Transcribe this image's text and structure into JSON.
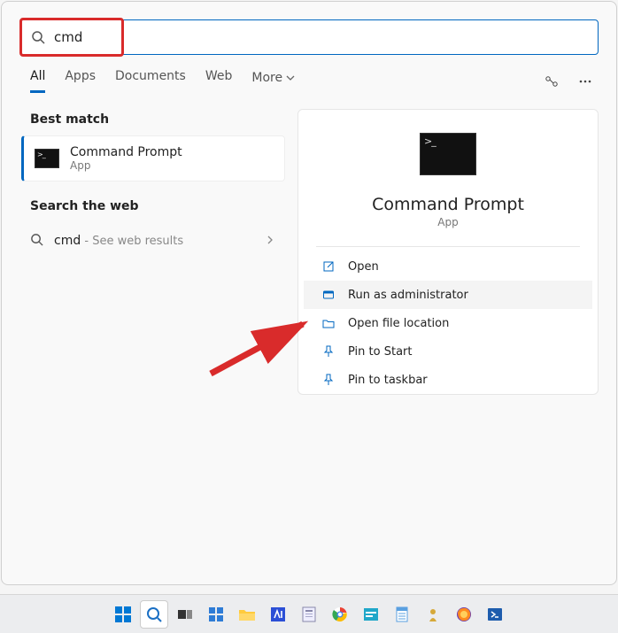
{
  "search": {
    "value": "cmd"
  },
  "tabs": {
    "all": "All",
    "apps": "Apps",
    "documents": "Documents",
    "web": "Web",
    "more": "More"
  },
  "left": {
    "best_match_label": "Best match",
    "match": {
      "title": "Command Prompt",
      "sub": "App"
    },
    "search_web_label": "Search the web",
    "web_item": {
      "term": "cmd",
      "suffix": " - See web results"
    }
  },
  "right": {
    "title": "Command Prompt",
    "sub": "App",
    "actions": {
      "open": "Open",
      "run_admin": "Run as administrator",
      "open_loc": "Open file location",
      "pin_start": "Pin to Start",
      "pin_taskbar": "Pin to taskbar"
    }
  },
  "taskbar": {
    "items": [
      "start",
      "search",
      "task-view",
      "widgets",
      "file-explorer",
      "app-blue",
      "app-clip",
      "chrome",
      "app-teal",
      "notepad",
      "app-gold",
      "firefox",
      "powershell"
    ]
  }
}
